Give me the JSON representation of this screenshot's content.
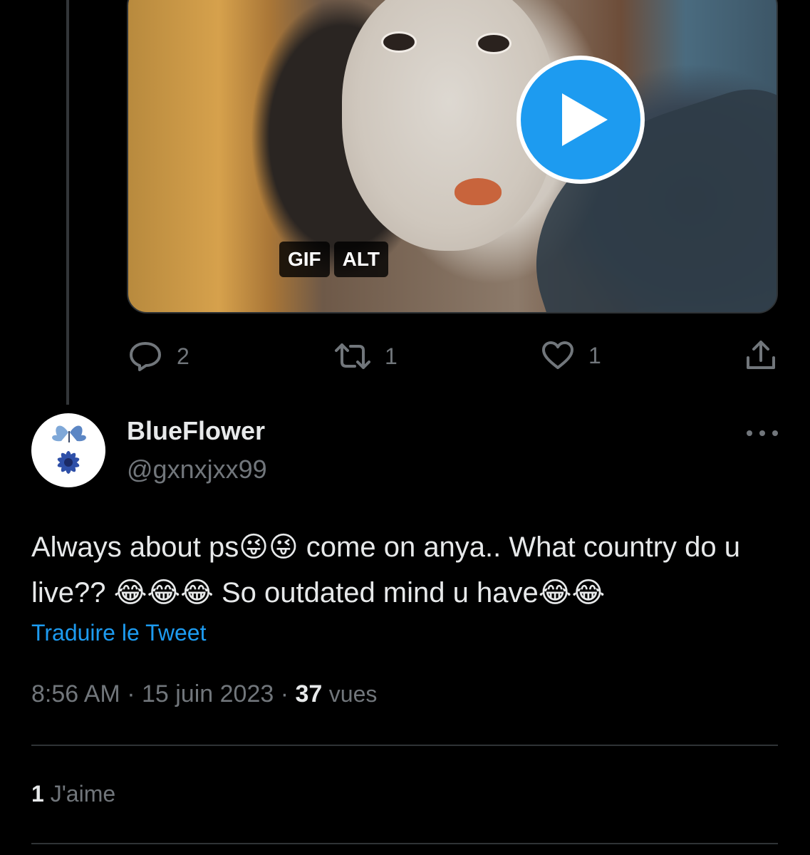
{
  "media": {
    "badges": [
      "GIF",
      "ALT"
    ],
    "play_icon": "play-icon"
  },
  "actions": {
    "reply": {
      "icon": "reply-icon",
      "count": "2"
    },
    "retweet": {
      "icon": "retweet-icon",
      "count": "1"
    },
    "like": {
      "icon": "heart-icon",
      "count": "1"
    },
    "share": {
      "icon": "share-icon"
    }
  },
  "reply_tweet": {
    "display_name": "BlueFlower",
    "handle": "@gxnxjxx99",
    "text": "Always about ps😜😜 come on anya.. What country do u live?? 😂😂😂 So outdated mind u have😂😂",
    "translate_label": "Traduire le Tweet",
    "time": "8:56 AM",
    "separator": "·",
    "date": "15 juin 2023",
    "views_count": "37",
    "views_label": "vues",
    "likes_count": "1",
    "likes_label": "J'aime"
  },
  "colors": {
    "background": "#000000",
    "text": "#e7e9ea",
    "muted": "#71767b",
    "accent": "#1d9bf0",
    "border": "#2f3336"
  }
}
